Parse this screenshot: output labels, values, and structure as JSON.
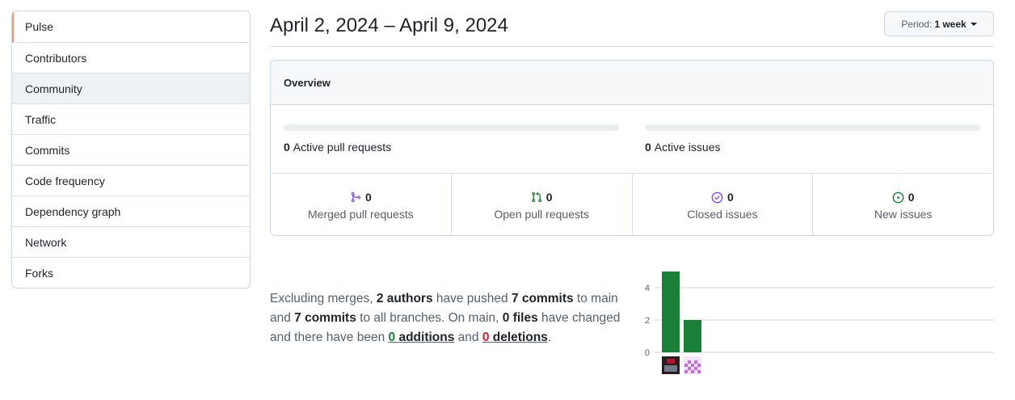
{
  "sidebar": {
    "items": [
      {
        "label": "Pulse"
      },
      {
        "label": "Contributors"
      },
      {
        "label": "Community"
      },
      {
        "label": "Traffic"
      },
      {
        "label": "Commits"
      },
      {
        "label": "Code frequency"
      },
      {
        "label": "Dependency graph"
      },
      {
        "label": "Network"
      },
      {
        "label": "Forks"
      }
    ]
  },
  "header": {
    "date_range": "April 2, 2024 – April 9, 2024",
    "period_label": "Period:",
    "period_value": "1 week"
  },
  "overview": {
    "title": "Overview",
    "active_prs_count": "0",
    "active_prs_label": "Active pull requests",
    "active_issues_count": "0",
    "active_issues_label": "Active issues",
    "stats": [
      {
        "count": "0",
        "label": "Merged pull requests",
        "icon": "git-merge-icon",
        "color": "#8250df"
      },
      {
        "count": "0",
        "label": "Open pull requests",
        "icon": "git-pull-request-icon",
        "color": "#1a7f37"
      },
      {
        "count": "0",
        "label": "Closed issues",
        "icon": "issue-closed-icon",
        "color": "#8250df"
      },
      {
        "count": "0",
        "label": "New issues",
        "icon": "issue-opened-icon",
        "color": "#1a7f37"
      }
    ]
  },
  "summary": {
    "t1": "Excluding merges, ",
    "authors": "2 authors",
    "t2": " have pushed ",
    "commits_main": "7 commits",
    "t3": " to main and ",
    "commits_all": "7 commits",
    "t4": " to all branches. On main, ",
    "files": "0 files",
    "t5": " have changed and there have been ",
    "additions_num": "0",
    "additions_word": "additions",
    "t6": " and ",
    "deletions_num": "0",
    "deletions_word": "deletions",
    "t7": "."
  },
  "chart_data": {
    "type": "bar",
    "categories": [
      "author-1",
      "author-2"
    ],
    "values": [
      5,
      2
    ],
    "yticks": [
      0,
      2,
      4
    ],
    "ylim": [
      0,
      5
    ],
    "bar_color": "#1a7f37",
    "grid_color": "#d0d7de"
  }
}
